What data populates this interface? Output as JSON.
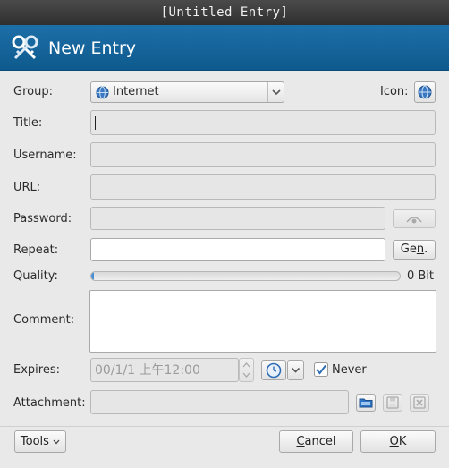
{
  "window": {
    "title": "[Untitled Entry]"
  },
  "banner": {
    "title": "New Entry",
    "icon": "keys-icon"
  },
  "form": {
    "group_label": "Group:",
    "group_value": "Internet",
    "icon_label": "Icon:",
    "title_label": "Title:",
    "title_value": "",
    "username_label": "Username:",
    "username_value": "",
    "url_label": "URL:",
    "url_value": "",
    "password_label": "Password:",
    "password_value": "",
    "repeat_label": "Repeat:",
    "repeat_value": "",
    "gen_label_prefix": "Ge",
    "gen_label_accel": "n",
    "gen_label_suffix": ".",
    "quality_label": "Quality:",
    "quality_value": "0 Bit",
    "quality_fraction": 0.01,
    "comment_label": "Comment:",
    "comment_value": "",
    "expires_label": "Expires:",
    "expires_value": "00/1/1 上午12:00",
    "never_label": "Never",
    "never_checked": true,
    "attachment_label": "Attachment:",
    "attachment_value": ""
  },
  "footer": {
    "tools_label": "Tools",
    "cancel_accel": "C",
    "cancel_rest": "ancel",
    "ok_accel": "O",
    "ok_rest": "K"
  },
  "colors": {
    "banner": "#1466a0",
    "accent": "#4a8fd6"
  }
}
